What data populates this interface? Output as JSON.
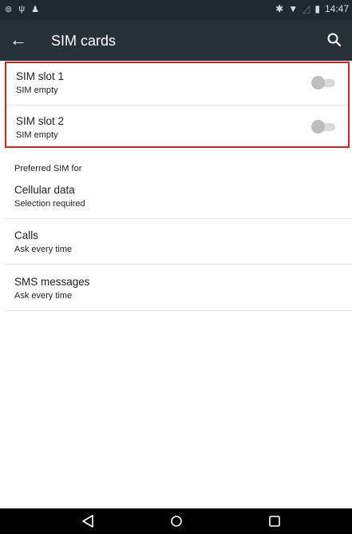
{
  "status_bar": {
    "time": "14:47"
  },
  "app_bar": {
    "title": "SIM cards",
    "back_icon": "arrow-left-icon",
    "search_icon": "search-icon"
  },
  "sim_slots": [
    {
      "title": "SIM slot 1",
      "subtitle": "SIM empty",
      "enabled": false
    },
    {
      "title": "SIM slot 2",
      "subtitle": "SIM empty",
      "enabled": false
    }
  ],
  "preferred": {
    "header": "Preferred SIM for",
    "items": [
      {
        "title": "Cellular data",
        "subtitle": "Selection required"
      },
      {
        "title": "Calls",
        "subtitle": "Ask every time"
      },
      {
        "title": "SMS messages",
        "subtitle": "Ask every time"
      }
    ]
  },
  "colors": {
    "app_bar": "#263238",
    "highlight": "#e02020"
  }
}
